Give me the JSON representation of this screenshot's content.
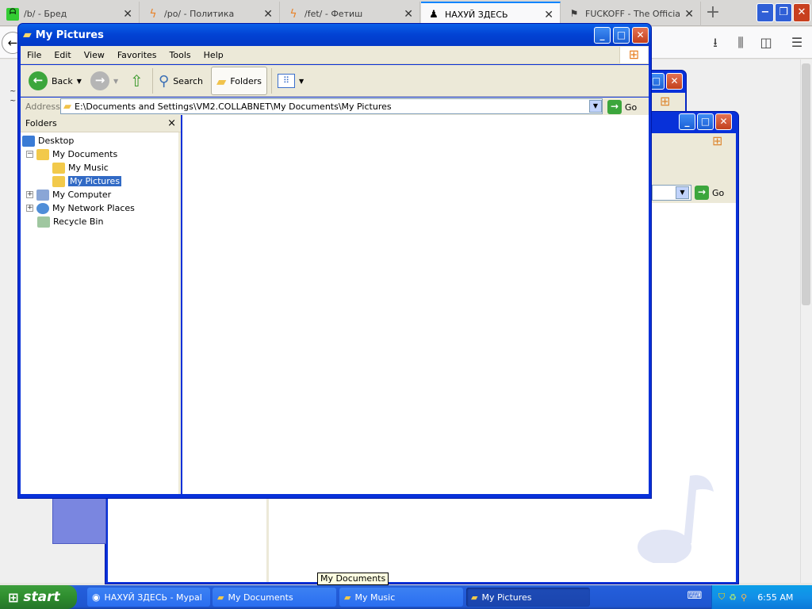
{
  "firefox": {
    "tabs": [
      {
        "label": "/b/ - Бред",
        "icon": "fire-icon",
        "active": false
      },
      {
        "label": "/po/ - Политика",
        "icon": "lightning-icon",
        "active": false
      },
      {
        "label": "/fet/ - Фетиш",
        "icon": "lightning-icon",
        "active": false
      },
      {
        "label": "НАХУЙ ЗДЕСЬ",
        "icon": "person-icon",
        "active": true
      },
      {
        "label": "FUCKOFF - The Official",
        "icon": "flag-icon",
        "active": false
      }
    ],
    "new_tab": "+",
    "window_controls": [
      "−",
      "❐",
      "✕"
    ]
  },
  "explorer_main": {
    "title": "My Pictures",
    "menu": [
      "File",
      "Edit",
      "View",
      "Favorites",
      "Tools",
      "Help"
    ],
    "toolbar": {
      "back": "Back",
      "search": "Search",
      "folders": "Folders"
    },
    "address_label": "Address",
    "address_value": "E:\\Documents and Settings\\VM2.COLLABNET\\My Documents\\My Pictures",
    "go": "Go",
    "folders_header": "Folders",
    "folders_close": "×",
    "tree": [
      {
        "label": "Desktop",
        "indent": 0,
        "expander": "",
        "selected": false,
        "icon": "desktop-icon"
      },
      {
        "label": "My Documents",
        "indent": 1,
        "expander": "−",
        "selected": false,
        "icon": "folder-icon"
      },
      {
        "label": "My Music",
        "indent": 2,
        "expander": "",
        "selected": false,
        "icon": "music-folder-icon"
      },
      {
        "label": "My Pictures",
        "indent": 2,
        "expander": "",
        "selected": true,
        "icon": "pictures-folder-icon"
      },
      {
        "label": "My Computer",
        "indent": 1,
        "expander": "+",
        "selected": false,
        "icon": "computer-icon"
      },
      {
        "label": "My Network Places",
        "indent": 1,
        "expander": "+",
        "selected": false,
        "icon": "network-icon"
      },
      {
        "label": "Recycle Bin",
        "indent": 1,
        "expander": "",
        "selected": false,
        "icon": "recycle-bin-icon"
      }
    ]
  },
  "explorer_back": {
    "go": "Go"
  },
  "tooltip": "My Documents",
  "taskbar": {
    "start": "start",
    "buttons": [
      {
        "label": "НАХУЙ ЗДЕСЬ - Mypal",
        "active": false
      },
      {
        "label": "My Documents",
        "active": false
      },
      {
        "label": "My Music",
        "active": false
      },
      {
        "label": "My Pictures",
        "active": true
      }
    ],
    "clock": "6:55 AM"
  },
  "colors": {
    "xp_blue": "#0a5fe8",
    "start_green": "#3c9e3c",
    "selection": "#316ac5"
  }
}
